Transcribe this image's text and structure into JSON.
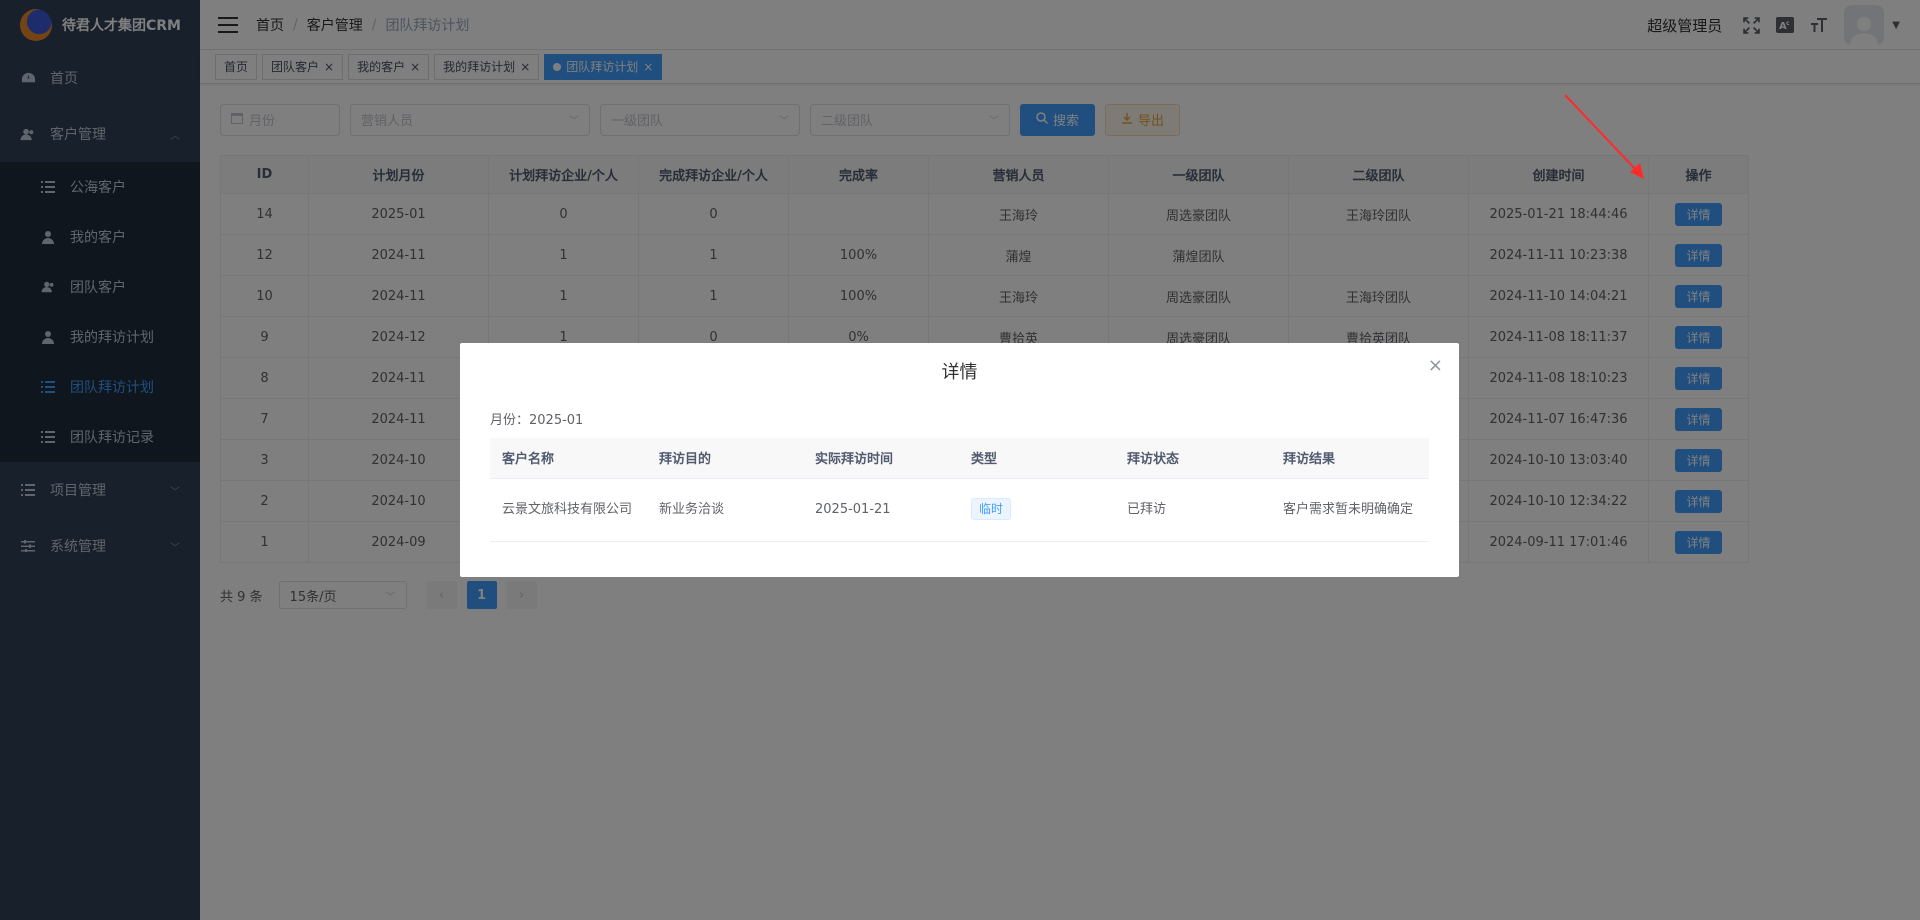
{
  "app": {
    "title": "待君人才集团CRM"
  },
  "sidebar": {
    "items": [
      {
        "label": "首页"
      },
      {
        "label": "客户管理"
      },
      {
        "label": "项目管理"
      },
      {
        "label": "系统管理"
      }
    ],
    "sub_items": [
      {
        "label": "公海客户"
      },
      {
        "label": "我的客户"
      },
      {
        "label": "团队客户"
      },
      {
        "label": "我的拜访计划"
      },
      {
        "label": "团队拜访计划"
      },
      {
        "label": "团队拜访记录"
      }
    ]
  },
  "navbar": {
    "breadcrumb": [
      "首页",
      "客户管理",
      "团队拜访计划"
    ],
    "user_name": "超级管理员"
  },
  "tags": [
    "首页",
    "团队客户",
    "我的客户",
    "我的拜访计划",
    "团队拜访计划"
  ],
  "filters": {
    "month_placeholder": "月份",
    "sales_placeholder": "营销人员",
    "team1_placeholder": "一级团队",
    "team2_placeholder": "二级团队",
    "search_label": "搜索",
    "export_label": "导出"
  },
  "table": {
    "columns": [
      "ID",
      "计划月份",
      "计划拜访企业/个人",
      "完成拜访企业/个人",
      "完成率",
      "营销人员",
      "一级团队",
      "二级团队",
      "创建时间",
      "操作"
    ],
    "detail_label": "详情",
    "rows": [
      [
        "14",
        "2025-01",
        "0",
        "0",
        "",
        "王海玲",
        "周选豪团队",
        "王海玲团队",
        "2025-01-21 18:44:46"
      ],
      [
        "12",
        "2024-11",
        "1",
        "1",
        "100%",
        "蒲煌",
        "蒲煌团队",
        "",
        "2024-11-11 10:23:38"
      ],
      [
        "10",
        "2024-11",
        "1",
        "1",
        "100%",
        "王海玲",
        "周选豪团队",
        "王海玲团队",
        "2024-11-10 14:04:21"
      ],
      [
        "9",
        "2024-12",
        "1",
        "0",
        "0%",
        "曹拾英",
        "周选豪团队",
        "曹拾英团队",
        "2024-11-08 18:11:37"
      ],
      [
        "8",
        "2024-11",
        "",
        "",
        "",
        "",
        "",
        "",
        "2024-11-08 18:10:23"
      ],
      [
        "7",
        "2024-11",
        "",
        "",
        "",
        "",
        "",
        "",
        "2024-11-07 16:47:36"
      ],
      [
        "3",
        "2024-10",
        "",
        "",
        "",
        "",
        "",
        "",
        "2024-10-10 13:03:40"
      ],
      [
        "2",
        "2024-10",
        "",
        "",
        "",
        "",
        "",
        "",
        "2024-10-10 12:34:22"
      ],
      [
        "1",
        "2024-09",
        "",
        "",
        "",
        "",
        "",
        "",
        "2024-09-11 17:01:46"
      ]
    ]
  },
  "pager": {
    "total": "共 9 条",
    "size": "15条/页",
    "page": "1"
  },
  "dialog": {
    "title": "详情",
    "month": "月份：2025-01",
    "columns": [
      "客户名称",
      "拜访目的",
      "实际拜访时间",
      "类型",
      "拜访状态",
      "拜访结果"
    ],
    "row": {
      "customer": "云景文旅科技有限公司",
      "purpose": "新业务洽谈",
      "time": "2025-01-21",
      "type": "临时",
      "status": "已拜访",
      "result": "客户需求暂未明确确定"
    }
  },
  "colors": {
    "primary": "#409eff",
    "sidebar": "#304156",
    "success": "#13ce66",
    "danger": "#ff4949"
  }
}
